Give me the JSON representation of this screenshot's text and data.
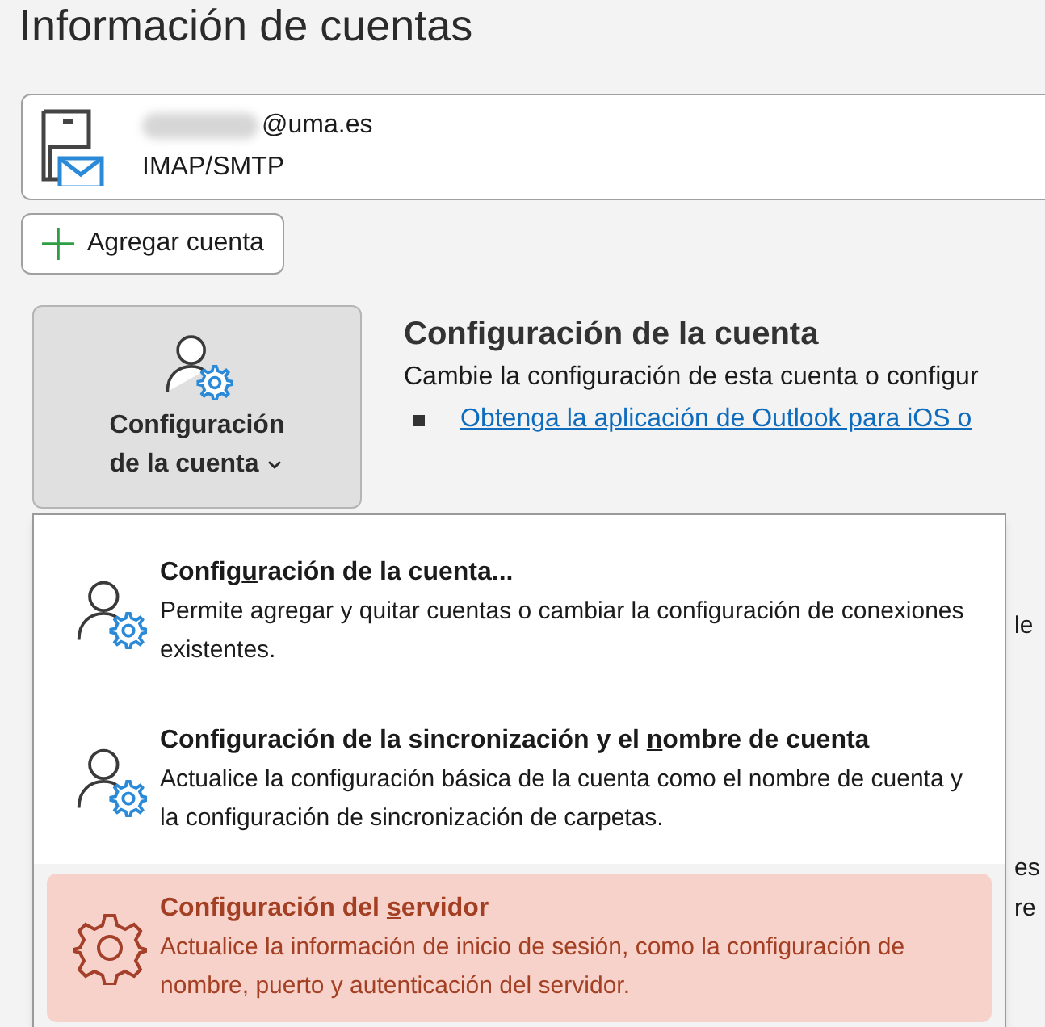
{
  "page_title": "Información de cuentas",
  "account": {
    "email": "@uma.es",
    "type": "IMAP/SMTP"
  },
  "add_account_button": {
    "label": "Agregar cuenta"
  },
  "account_settings_button": {
    "label_lines": [
      "Configuración",
      "de la cuenta"
    ],
    "expanded": true
  },
  "section": {
    "title": "Configuración de la cuenta",
    "description": "Cambie la configuración de esta cuenta o configur",
    "link": "Obtenga la aplicación de Outlook para iOS o"
  },
  "background_fragments": [
    "le",
    "es",
    "re"
  ],
  "menu": {
    "items": [
      {
        "kind": "account",
        "title": {
          "before": "Config",
          "key": "u",
          "after": "ración de la cuenta..."
        },
        "description": "Permite agregar y quitar cuentas o cambiar la configuración de conexiones existentes.",
        "selected": false
      },
      {
        "kind": "account",
        "title": {
          "before": "Configuración de la sincronización y el ",
          "key": "n",
          "after": "ombre de cuenta"
        },
        "description": "Actualice la configuración básica de la cuenta como el nombre de cuenta y la configuración de sincronización de carpetas.",
        "selected": false
      },
      {
        "kind": "server",
        "title": {
          "before": "Configuración del ",
          "key": "s",
          "after": "ervidor"
        },
        "description": "Actualice la información de inicio de sesión, como la configuración de nombre, puerto y autenticación del servidor.",
        "selected": true
      }
    ]
  }
}
